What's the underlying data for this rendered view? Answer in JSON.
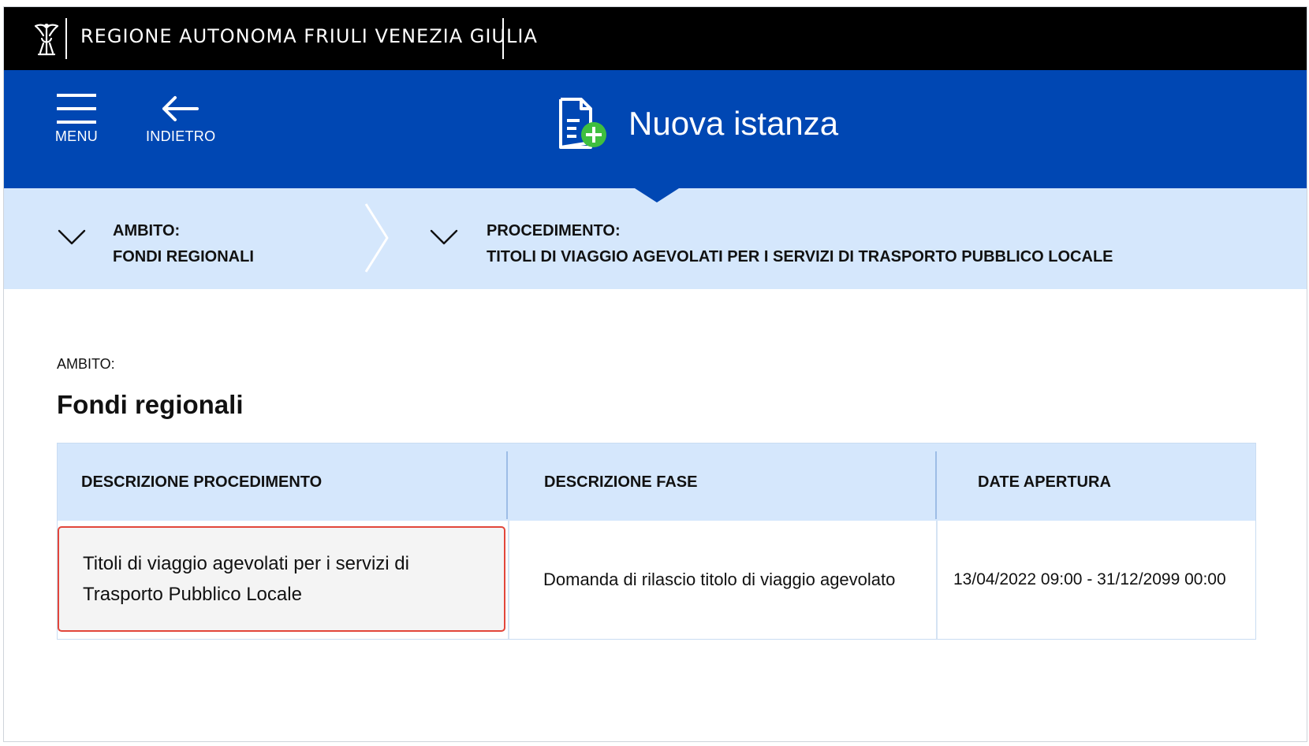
{
  "topbar": {
    "region_name": "REGIONE AUTONOMA FRIULI VENEZIA GIULIA",
    "logo_icon": "eagle-logo-icon"
  },
  "header": {
    "menu_label": "MENU",
    "back_label": "INDIETRO",
    "page_title": "Nuova istanza",
    "title_icon": "document-add-icon",
    "accent_color": "#0047b3",
    "plus_color": "#3fbf3f"
  },
  "breadcrumbs": [
    {
      "label": "AMBITO:",
      "value": "FONDI REGIONALI"
    },
    {
      "label": "PROCEDIMENTO:",
      "value": "TITOLI DI VIAGGIO AGEVOLATI PER I SERVIZI DI TRASPORTO PUBBLICO LOCALE"
    }
  ],
  "content": {
    "ambito_label": "AMBITO:",
    "section_title": "Fondi regionali"
  },
  "table": {
    "headers": [
      "DESCRIZIONE PROCEDIMENTO",
      "DESCRIZIONE FASE",
      "DATE APERTURA"
    ],
    "rows": [
      {
        "procedimento_line1": "Titoli di viaggio agevolati per i servizi di",
        "procedimento_line2": "Trasporto Pubblico Locale",
        "fase": "Domanda di rilascio titolo di viaggio agevolato",
        "date": "13/04/2022 09:00 - 31/12/2099 00:00"
      }
    ],
    "highlight_color": "#e2463a"
  }
}
